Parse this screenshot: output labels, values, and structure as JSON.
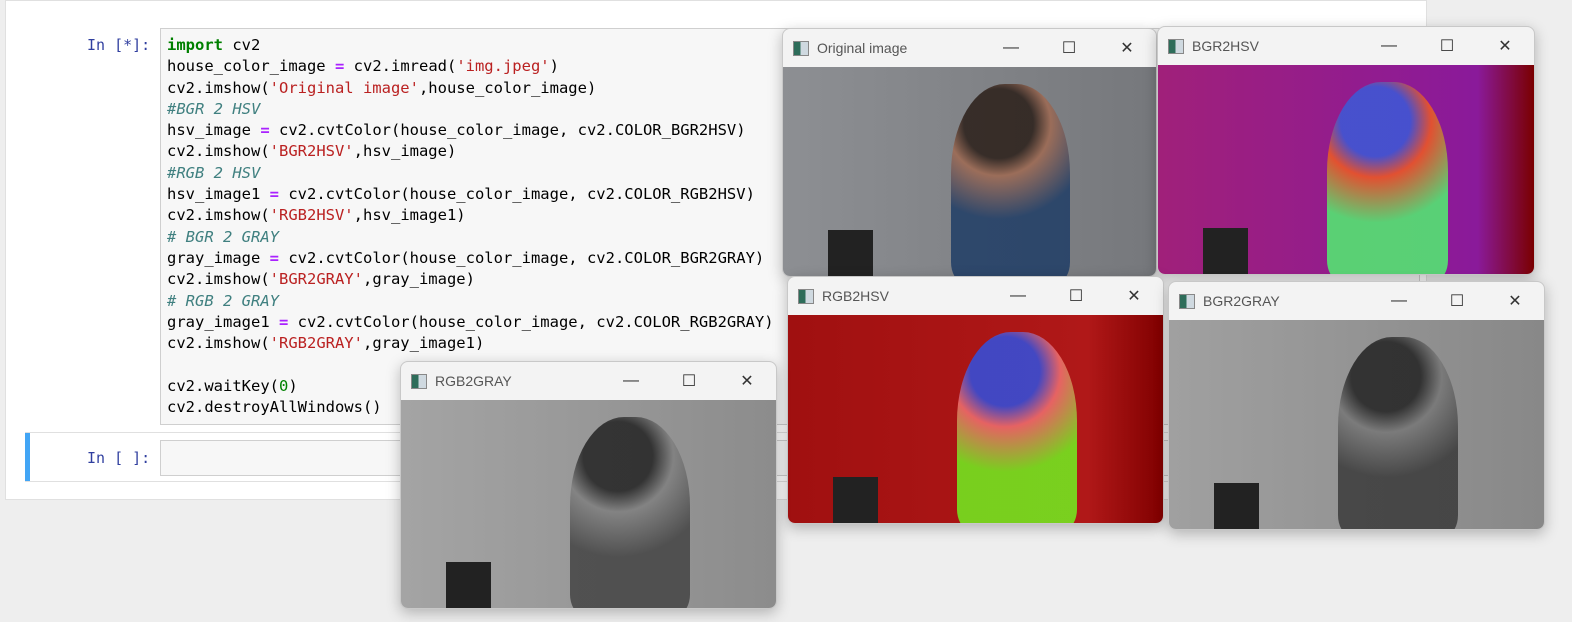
{
  "notebook": {
    "cell1": {
      "prompt": "In [*]:",
      "lines": [
        [
          [
            "kw",
            "import"
          ],
          [
            "",
            " cv2"
          ]
        ],
        [
          [
            "",
            "house_color_image "
          ],
          [
            "op",
            "="
          ],
          [
            "",
            " cv2.imread("
          ],
          [
            "str",
            "'img.jpeg'"
          ],
          [
            "",
            ")"
          ]
        ],
        [
          [
            "",
            "cv2.imshow("
          ],
          [
            "str",
            "'Original image'"
          ],
          [
            "",
            ",house_color_image)"
          ]
        ],
        [
          [
            "cm",
            "#BGR 2 HSV"
          ]
        ],
        [
          [
            "",
            "hsv_image "
          ],
          [
            "op",
            "="
          ],
          [
            "",
            " cv2.cvtColor(house_color_image, cv2.COLOR_BGR2HSV)"
          ]
        ],
        [
          [
            "",
            "cv2.imshow("
          ],
          [
            "str",
            "'BGR2HSV'"
          ],
          [
            "",
            ",hsv_image)"
          ]
        ],
        [
          [
            "cm",
            "#RGB 2 HSV"
          ]
        ],
        [
          [
            "",
            "hsv_image1 "
          ],
          [
            "op",
            "="
          ],
          [
            "",
            " cv2.cvtColor(house_color_image, cv2.COLOR_RGB2HSV)"
          ]
        ],
        [
          [
            "",
            "cv2.imshow("
          ],
          [
            "str",
            "'RGB2HSV'"
          ],
          [
            "",
            ",hsv_image1)"
          ]
        ],
        [
          [
            "cm",
            "# BGR 2 GRAY"
          ]
        ],
        [
          [
            "",
            "gray_image "
          ],
          [
            "op",
            "="
          ],
          [
            "",
            " cv2.cvtColor(house_color_image, cv2.COLOR_BGR2GRAY)"
          ]
        ],
        [
          [
            "",
            "cv2.imshow("
          ],
          [
            "str",
            "'BGR2GRAY'"
          ],
          [
            "",
            ",gray_image)"
          ]
        ],
        [
          [
            "cm",
            "# RGB 2 GRAY"
          ]
        ],
        [
          [
            "",
            "gray_image1 "
          ],
          [
            "op",
            "="
          ],
          [
            "",
            " cv2.cvtColor(house_color_image, cv2.COLOR_RGB2GRAY)"
          ]
        ],
        [
          [
            "",
            "cv2.imshow("
          ],
          [
            "str",
            "'RGB2GRAY'"
          ],
          [
            "",
            ",gray_image1)"
          ]
        ],
        [
          [
            "",
            ""
          ]
        ],
        [
          [
            "",
            "cv2.waitKey("
          ],
          [
            "num",
            "0"
          ],
          [
            "",
            ")"
          ]
        ],
        [
          [
            "",
            "cv2.destroyAllWindows()"
          ]
        ]
      ]
    },
    "cell2": {
      "prompt": "In [ ]:"
    }
  },
  "windows": [
    {
      "title": "Original image",
      "minimize": "—",
      "maximize": "☐",
      "close": "✕"
    },
    {
      "title": "BGR2HSV",
      "minimize": "—",
      "maximize": "☐",
      "close": "✕"
    },
    {
      "title": "RGB2HSV",
      "minimize": "—",
      "maximize": "☐",
      "close": "✕"
    },
    {
      "title": "BGR2GRAY",
      "minimize": "—",
      "maximize": "☐",
      "close": "✕"
    },
    {
      "title": "RGB2GRAY",
      "minimize": "—",
      "maximize": "☐",
      "close": "✕"
    }
  ],
  "colors": {
    "accent": "#42a5f5",
    "prompt": "#303f9f"
  }
}
